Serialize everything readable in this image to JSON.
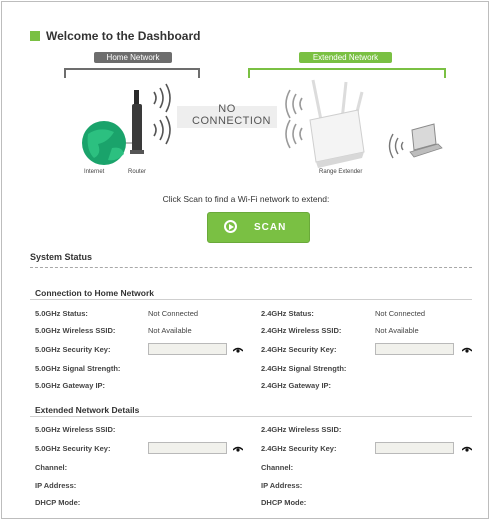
{
  "header": {
    "title": "Welcome to the Dashboard"
  },
  "diagram": {
    "home_tag": "Home Network",
    "extended_tag": "Extended Network",
    "no_connection": [
      "NO",
      "CONNECTION"
    ],
    "internet_label": "Internet",
    "router_label": "Router",
    "extender_label": "Range Extender"
  },
  "scan": {
    "prompt": "Click Scan to find a Wi-Fi network to extend:",
    "button_label": "SCAN"
  },
  "status": {
    "title": "System Status",
    "home": {
      "title": "Connection to Home Network",
      "left": {
        "status_label": "5.0GHz Status:",
        "status_value": "Not Connected",
        "ssid_label": "5.0GHz Wireless SSID:",
        "ssid_value": "Not Available",
        "key_label": "5.0GHz Security Key:",
        "signal_label": "5.0GHz Signal Strength:",
        "gateway_label": "5.0GHz Gateway IP:"
      },
      "right": {
        "status_label": "2.4GHz Status:",
        "status_value": "Not Connected",
        "ssid_label": "2.4GHz Wireless SSID:",
        "ssid_value": "Not Available",
        "key_label": "2.4GHz Security Key:",
        "signal_label": "2.4GHz Signal Strength:",
        "gateway_label": "2.4GHz Gateway IP:"
      }
    },
    "extended": {
      "title": "Extended Network Details",
      "left": {
        "ssid_label": "5.0GHz Wireless SSID:",
        "key_label": "5.0GHz Security Key:",
        "channel_label": "Channel:",
        "ip_label": "IP Address:",
        "dhcp_label": "DHCP Mode:"
      },
      "right": {
        "ssid_label": "2.4GHz Wireless SSID:",
        "key_label": "2.4GHz Security Key:",
        "channel_label": "Channel:",
        "ip_label": "IP Address:",
        "dhcp_label": "DHCP Mode:"
      }
    }
  },
  "colors": {
    "accent": "#7ac043",
    "home_gray": "#6d6d6d"
  }
}
